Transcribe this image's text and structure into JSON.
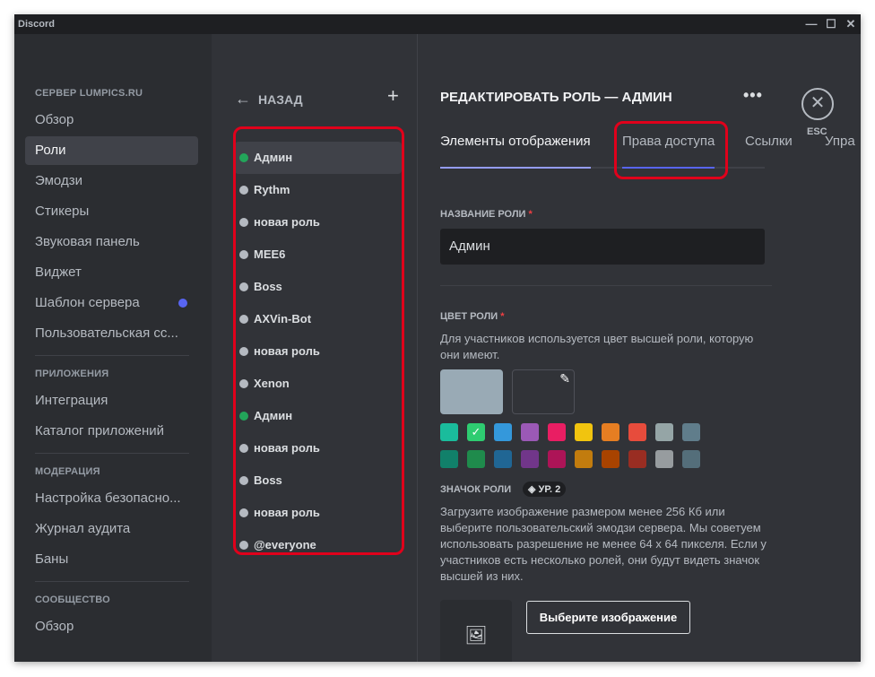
{
  "app": {
    "title": "Discord",
    "min": "—",
    "max": "☐",
    "close": "✕"
  },
  "sidebar": {
    "sections": [
      {
        "title": "СЕРВЕР LUMPICS.RU",
        "items": [
          "Обзор",
          "Роли",
          "Эмодзи",
          "Стикеры",
          "Звуковая панель",
          "Виджет",
          "Шаблон сервера",
          "Пользовательская сс..."
        ]
      },
      {
        "title": "ПРИЛОЖЕНИЯ",
        "items": [
          "Интеграция",
          "Каталог приложений"
        ]
      },
      {
        "title": "МОДЕРАЦИЯ",
        "items": [
          "Настройка безопасно...",
          "Журнал аудита",
          "Баны"
        ]
      },
      {
        "title": "СООБЩЕСТВО",
        "items": [
          "Обзор"
        ]
      }
    ]
  },
  "roles": {
    "back": "НАЗАД",
    "add": "+",
    "list": [
      {
        "name": "Админ",
        "color": "#23a55a"
      },
      {
        "name": "Rythm",
        "color": "#b5bac1"
      },
      {
        "name": "новая роль",
        "color": "#b5bac1"
      },
      {
        "name": "MEE6",
        "color": "#b5bac1"
      },
      {
        "name": "Boss",
        "color": "#b5bac1"
      },
      {
        "name": "AXVin-Bot",
        "color": "#b5bac1"
      },
      {
        "name": "новая роль",
        "color": "#b5bac1"
      },
      {
        "name": "Xenon",
        "color": "#b5bac1"
      },
      {
        "name": "Админ",
        "color": "#23a55a"
      },
      {
        "name": "новая роль",
        "color": "#b5bac1"
      },
      {
        "name": "Boss",
        "color": "#b5bac1"
      },
      {
        "name": "новая роль",
        "color": "#b5bac1"
      },
      {
        "name": "@everyone",
        "color": "#b5bac1"
      }
    ]
  },
  "main": {
    "title": "РЕДАКТИРОВАТЬ РОЛЬ — АДМИН",
    "more": "•••",
    "close": "✕",
    "esc": "ESC",
    "tabs": [
      "Элементы отображения",
      "Права доступа",
      "Ссылки",
      "Упра"
    ],
    "name_label": "НАЗВАНИЕ РОЛИ",
    "required": "*",
    "name_value": "Админ",
    "color_label": "ЦВЕТ РОЛИ",
    "color_desc": "Для участников используется цвет высшей роли, которую они имеют.",
    "current_color": "#99aab5",
    "swatches_row1": [
      "#1abc9c",
      "#2ecc71",
      "#3498db",
      "#9b59b6",
      "#e91e63",
      "#f1c40f",
      "#e67e22",
      "#e74c3c",
      "#95a5a6",
      "#607d8b"
    ],
    "swatches_row2": [
      "#11806a",
      "#1f8b4c",
      "#206694",
      "#71368a",
      "#ad1457",
      "#c27c0e",
      "#a84300",
      "#992d22",
      "#979c9f",
      "#546e7a"
    ],
    "selected_swatch": 1,
    "icon_label": "ЗНАЧОК РОЛИ",
    "level": "УР. 2",
    "icon_desc": "Загрузите изображение размером менее 256 Кб или выберите пользовательский эмодзи сервера. Мы советуем использовать разрешение не менее 64 x 64 пикселя. Если у участников есть несколько ролей, они будут видеть значок высшей из них.",
    "choose_image": "Выберите изображение"
  }
}
